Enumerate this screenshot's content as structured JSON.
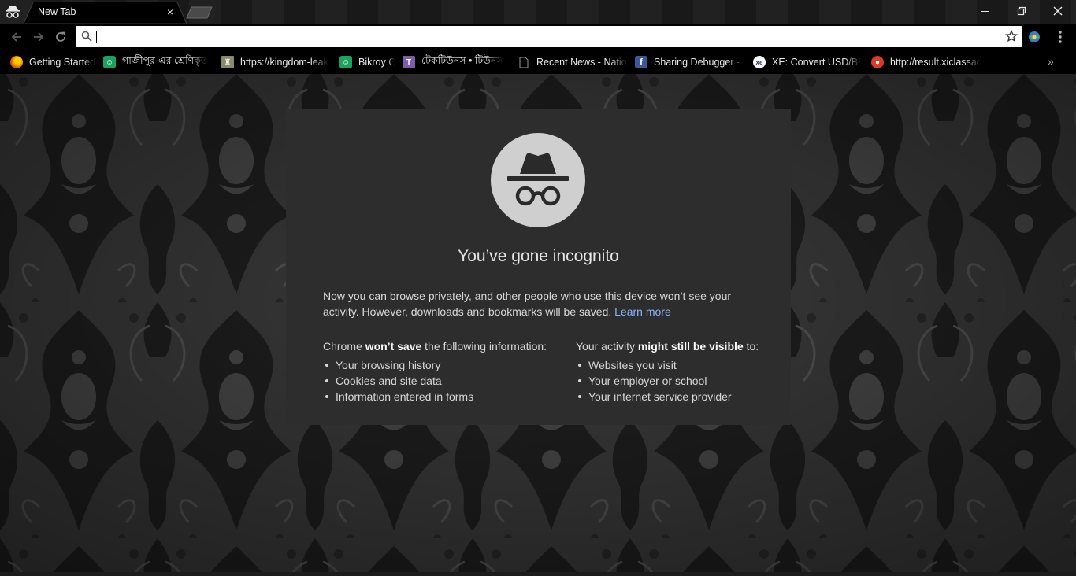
{
  "window": {
    "tab_title": "New Tab",
    "close_tab": "×",
    "minimize_icon": "minimize-icon",
    "restore_icon": "restore-icon",
    "close_icon": "close-icon"
  },
  "toolbar": {
    "omnibox_value": "",
    "icons": [
      "back-icon",
      "forward-icon",
      "reload-icon",
      "search-icon",
      "star-icon",
      "extension-icon",
      "menu-icon"
    ]
  },
  "bookmarks": {
    "items": [
      {
        "label": "Getting Started",
        "icon": "firefox-icon",
        "color": "#e66000"
      },
      {
        "label": "গাজীপুর-এর শ্রেণিকৃত",
        "icon": "bikroy-icon",
        "color": "#1aa260"
      },
      {
        "label": "https://kingdom-leaks",
        "icon": "castle-icon",
        "color": "#8a8a6a"
      },
      {
        "label": "Bikroy C",
        "icon": "bikroy-icon",
        "color": "#1aa260"
      },
      {
        "label": "টেকটিউনস • টিউনস",
        "icon": "techtunes-icon",
        "color": "#7b5ea7"
      },
      {
        "label": "Recent News - National",
        "icon": "page-icon",
        "color": "#000000"
      },
      {
        "label": "Sharing Debugger - Facebook",
        "icon": "facebook-icon",
        "color": "#3b5998"
      },
      {
        "label": "XE: Convert USD/BDT",
        "icon": "xe-icon",
        "color": "#1b3a6b"
      },
      {
        "label": "http://result.xiclassadmission",
        "icon": "result-icon",
        "color": "#d93b2b"
      }
    ],
    "more": "»"
  },
  "incognito": {
    "heading": "You’ve gone incognito",
    "intro": "Now you can browse privately, and other people who use this device won’t see your activity. However, downloads and bookmarks will be saved.",
    "learn_more": "Learn more",
    "left_prefix": "Chrome ",
    "left_bold": "won’t save",
    "left_suffix": " the following information:",
    "left_items": [
      "Your browsing history",
      "Cookies and site data",
      "Information entered in forms"
    ],
    "right_prefix": "Your activity ",
    "right_bold": "might still be visible",
    "right_suffix": " to:",
    "right_items": [
      "Websites you visit",
      "Your employer or school",
      "Your internet service provider"
    ]
  },
  "colors": {
    "page_background": "#3a3a3a",
    "card_background": "#2d2d2d",
    "link": "#8ab4f8",
    "chrome_bar": "#000000"
  }
}
